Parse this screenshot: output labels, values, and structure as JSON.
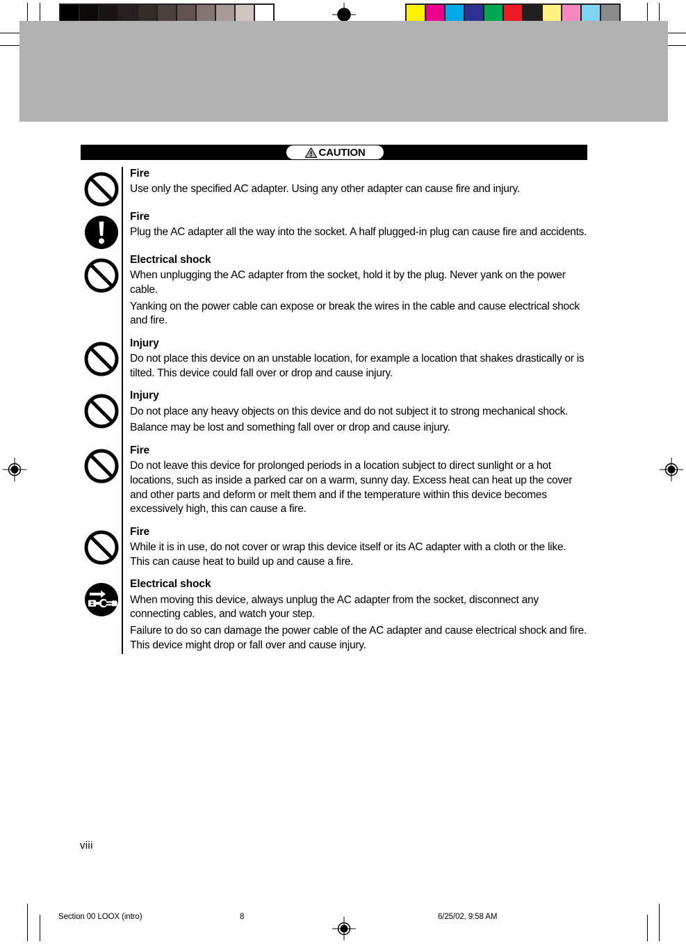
{
  "document": {
    "page_number_label": "viii",
    "banner": {
      "badge_label": "CAUTION",
      "badge_icon": "warning-triangle-icon"
    }
  },
  "notices": [
    {
      "icon": "prohibition-icon",
      "title": "Fire",
      "paragraphs": [
        "Use only the specified AC adapter. Using any other adapter can cause fire and injury."
      ]
    },
    {
      "icon": "mandatory-exclamation-icon",
      "title": "Fire",
      "paragraphs": [
        "Plug the AC adapter all the way into the socket. A half plugged-in plug can cause fire and accidents."
      ]
    },
    {
      "icon": "prohibition-icon",
      "title": "Electrical shock",
      "paragraphs": [
        "When unplugging the AC adapter from the socket, hold it by the plug.  Never yank on the power cable.",
        "Yanking on the power cable can expose or break the wires in the cable and cause electrical shock and fire."
      ]
    },
    {
      "icon": "prohibition-icon",
      "title": "Injury",
      "paragraphs": [
        "Do not place this device on an unstable location, for example a location that shakes drastically or is tilted. This device could fall over or drop and cause injury."
      ]
    },
    {
      "icon": "prohibition-icon",
      "title": "Injury",
      "paragraphs": [
        "Do not place any heavy objects on this device and do not subject it to strong mechanical shock.",
        "Balance may be lost and something fall over or drop and cause injury."
      ]
    },
    {
      "icon": "prohibition-icon",
      "title": "Fire",
      "paragraphs": [
        "Do not leave this device for prolonged periods in a location subject to direct sunlight or a hot locations, such as inside a parked car on a warm, sunny day. Excess heat can heat up the cover and other parts and deform or melt them and if the temperature within this device becomes excessively high, this can cause a fire."
      ]
    },
    {
      "icon": "prohibition-icon",
      "title": "Fire",
      "paragraphs": [
        "While it is in use, do not cover or wrap this device itself or its AC adapter with a cloth or the like. This can cause heat to build up and cause a fire."
      ]
    },
    {
      "icon": "unplug-adapter-icon",
      "title": "Electrical shock",
      "paragraphs": [
        "When moving this device, always unplug the AC adapter from the socket, disconnect any connecting cables, and watch your step.",
        "Failure to do so can damage the power cable of the AC adapter and cause electrical shock and fire. This device might drop or fall over and cause injury."
      ]
    }
  ],
  "footer": {
    "document_name": "Section 00 LOOX (intro)",
    "sheet_number": "8",
    "timestamp": "6/25/02, 9:58 AM"
  },
  "print_marks": {
    "grayscale_patches": [
      "#000000",
      "#0d0a0a",
      "#1a1514",
      "#26201e",
      "#332b28",
      "#4a403c",
      "#615450",
      "#837572",
      "#a89b97",
      "#d0c4c0",
      "#ffffff"
    ],
    "color_patches": [
      "#fff200",
      "#ec008c",
      "#00a8e8",
      "#2e3192",
      "#00a651",
      "#ed1c24",
      "#231f20",
      "#fff27f",
      "#f488c0",
      "#7fd4f4",
      "#8b8b8b"
    ],
    "header_band_color": "#b2b2b2"
  }
}
